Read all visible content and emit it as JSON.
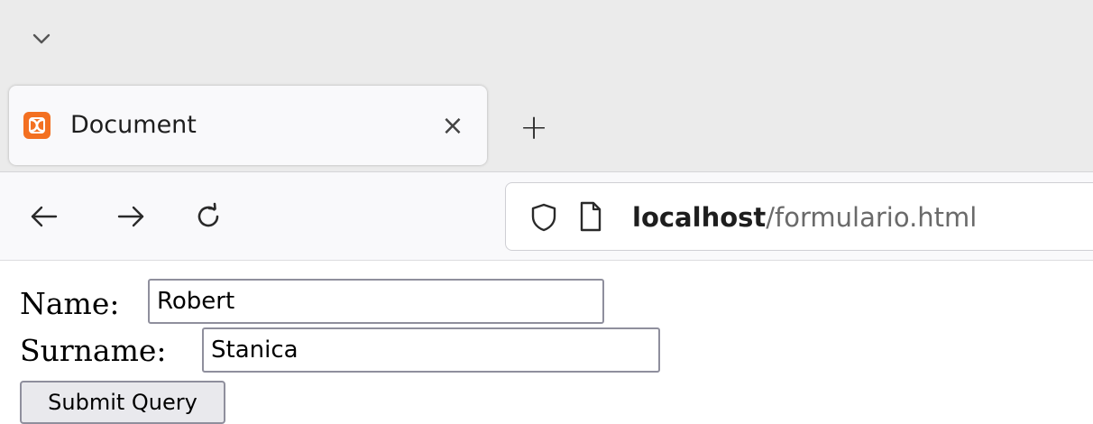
{
  "browser": {
    "tab": {
      "title": "Document",
      "close_glyph": "×",
      "favicon": "xampp-icon"
    },
    "new_tab_glyph": "+",
    "address_bar": {
      "host": "localhost",
      "path": "/formulario.html"
    },
    "colors": {
      "favicon": "#f37021",
      "chrome_bg": "#ebebeb"
    }
  },
  "form": {
    "name": {
      "label": "Name:",
      "value": "Robert"
    },
    "surname": {
      "label": "Surname:",
      "value": "Stanica"
    },
    "submit_label": "Submit Query"
  }
}
